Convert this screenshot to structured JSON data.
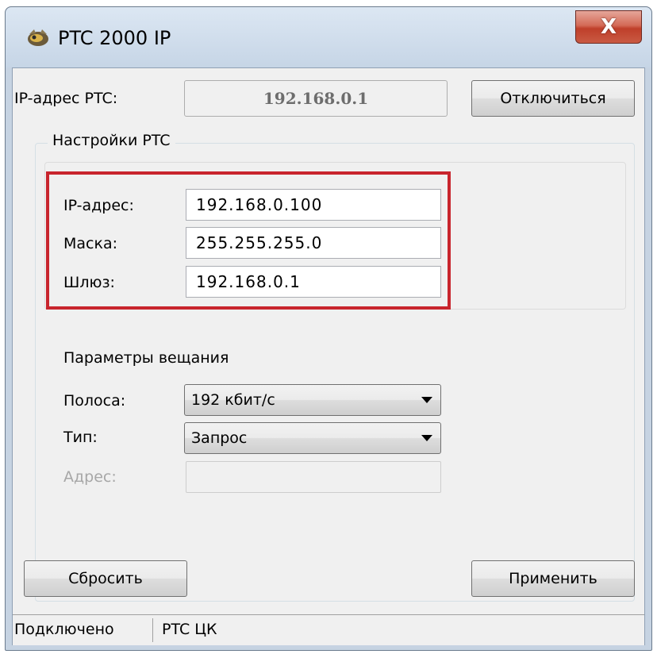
{
  "window": {
    "title": "PTC 2000 IP",
    "close_label": "X",
    "icon": "app-logo-icon"
  },
  "connection": {
    "ip_label": "IP-адрес PTC:",
    "ip_value": "192.168.0.1",
    "disconnect_label": "Отключиться"
  },
  "settings": {
    "group_title": "Настройки PTC",
    "ip_label": "IP-адрес:",
    "ip_value": "192.168.0.100",
    "mask_label": "Маска:",
    "mask_value": "255.255.255.0",
    "gateway_label": "Шлюз:",
    "gateway_value": "192.168.0.1"
  },
  "broadcast": {
    "section_title": "Параметры вещания",
    "band_label": "Полоса:",
    "band_value": "192 кбит/с",
    "type_label": "Тип:",
    "type_value": "Запрос",
    "address_label": "Адрес:",
    "address_value": ""
  },
  "actions": {
    "reset_label": "Сбросить",
    "apply_label": "Применить"
  },
  "status": {
    "state": "Подключено",
    "center": "PTC ЦК"
  },
  "colors": {
    "highlight": "#c8252d",
    "close_button": "#c94a35"
  }
}
